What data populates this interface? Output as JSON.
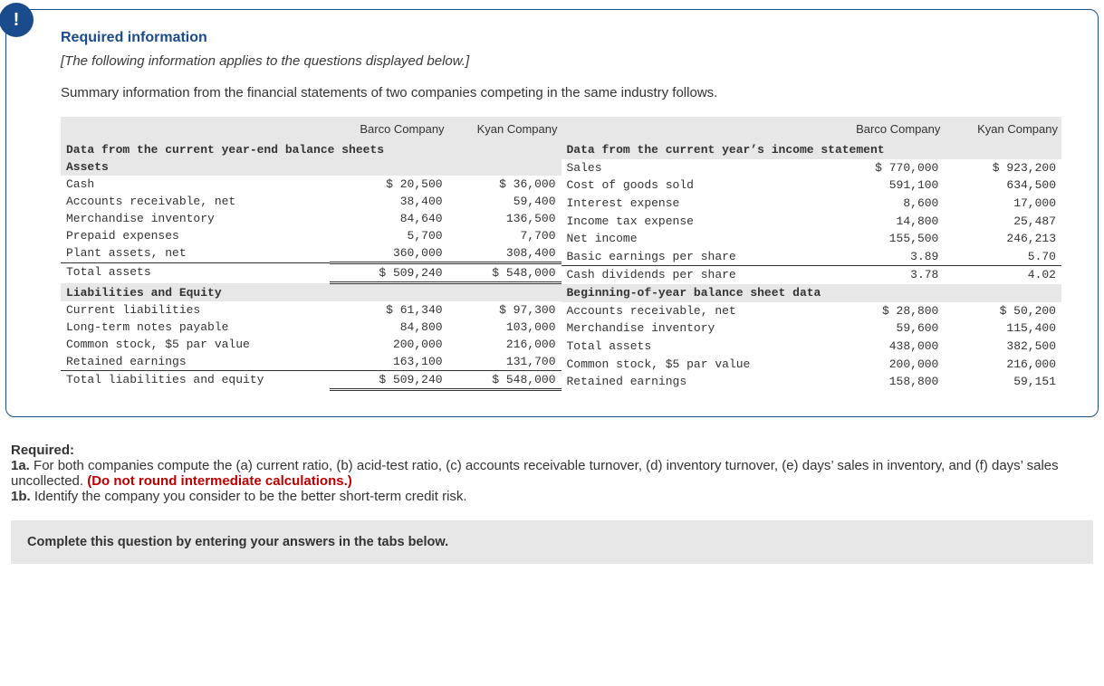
{
  "badge_glyph": "!",
  "info_title": "Required information",
  "sub_note": "[The following information applies to the questions displayed below.]",
  "summary": "Summary information from the financial statements of two companies competing in the same industry follows.",
  "col_barco": "Barco Company",
  "col_kyan": "Kyan Company",
  "left": {
    "hdr1": "Data from the current year-end balance sheets",
    "assets_hdr": "Assets",
    "rows": [
      {
        "label": "Cash",
        "b": "$ 20,500",
        "k": "$ 36,000"
      },
      {
        "label": "Accounts receivable, net",
        "b": "38,400",
        "k": "59,400"
      },
      {
        "label": "Merchandise inventory",
        "b": "84,640",
        "k": "136,500"
      },
      {
        "label": "Prepaid expenses",
        "b": "5,700",
        "k": "7,700"
      },
      {
        "label": "Plant assets, net",
        "b": "360,000",
        "k": "308,400"
      }
    ],
    "total_assets": {
      "label": "Total assets",
      "b": "$ 509,240",
      "k": "$ 548,000"
    },
    "le_hdr": "Liabilities and Equity",
    "le_rows": [
      {
        "label": "Current liabilities",
        "b": "$ 61,340",
        "k": "$ 97,300"
      },
      {
        "label": "Long-term notes payable",
        "b": "84,800",
        "k": "103,000"
      },
      {
        "label": "Common stock, $5 par value",
        "b": "200,000",
        "k": "216,000"
      },
      {
        "label": "Retained earnings",
        "b": "163,100",
        "k": "131,700"
      }
    ],
    "total_le": {
      "label": "Total liabilities and equity",
      "b": "$ 509,240",
      "k": "$ 548,000"
    }
  },
  "right": {
    "hdr1": "Data from the current year’s income statement",
    "rows": [
      {
        "label": "Sales",
        "b": "$ 770,000",
        "k": "$ 923,200"
      },
      {
        "label": "Cost of goods sold",
        "b": "591,100",
        "k": "634,500"
      },
      {
        "label": "Interest expense",
        "b": "8,600",
        "k": "17,000"
      },
      {
        "label": "Income tax expense",
        "b": "14,800",
        "k": "25,487"
      },
      {
        "label": "Net income",
        "b": "155,500",
        "k": "246,213"
      },
      {
        "label": "Basic earnings per share",
        "b": "3.89",
        "k": "5.70"
      }
    ],
    "cash_div": {
      "label": "Cash dividends per share",
      "b": "3.78",
      "k": "4.02"
    },
    "boy_hdr": "Beginning-of-year balance sheet data",
    "boy_rows": [
      {
        "label": "Accounts receivable, net",
        "b": "$ 28,800",
        "k": "$ 50,200"
      },
      {
        "label": "Merchandise inventory",
        "b": "59,600",
        "k": "115,400"
      },
      {
        "label": "Total assets",
        "b": "438,000",
        "k": "382,500"
      },
      {
        "label": "Common stock, $5 par value",
        "b": "200,000",
        "k": "216,000"
      },
      {
        "label": "Retained earnings",
        "b": "158,800",
        "k": "59,151"
      }
    ]
  },
  "req": {
    "hdr": "Required:",
    "line1a_strong": "1a.",
    "line1a_text": " For both companies compute the (a) current ratio, (b) acid-test ratio, (c) accounts receivable turnover, (d) inventory turnover, (e) days’ sales in inventory, and (f) days’ sales uncollected. ",
    "line1a_red": "(Do not round intermediate calculations.)",
    "line1b_strong": "1b.",
    "line1b_text": " Identify the company you consider to be the better short-term credit risk."
  },
  "answer_bar": "Complete this question by entering your answers in the tabs below."
}
